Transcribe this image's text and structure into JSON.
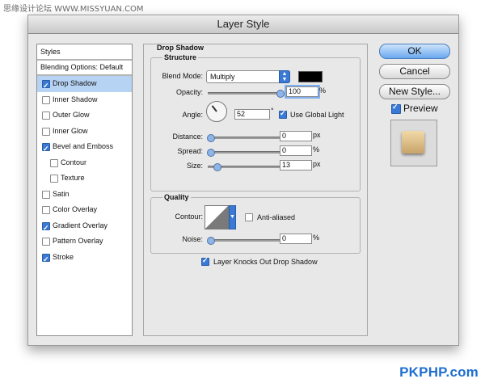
{
  "watermark_top": "思缘设计论坛 WWW.MISSYUAN.COM",
  "watermark_bottom": "PKPHP.com",
  "window": {
    "title": "Layer Style"
  },
  "styles_panel": {
    "header": "Styles",
    "blending_options": "Blending Options: Default",
    "items": [
      {
        "label": "Drop Shadow",
        "checked": true,
        "selected": true,
        "sub": false
      },
      {
        "label": "Inner Shadow",
        "checked": false,
        "selected": false,
        "sub": false
      },
      {
        "label": "Outer Glow",
        "checked": false,
        "selected": false,
        "sub": false
      },
      {
        "label": "Inner Glow",
        "checked": false,
        "selected": false,
        "sub": false
      },
      {
        "label": "Bevel and Emboss",
        "checked": true,
        "selected": false,
        "sub": false
      },
      {
        "label": "Contour",
        "checked": false,
        "selected": false,
        "sub": true
      },
      {
        "label": "Texture",
        "checked": false,
        "selected": false,
        "sub": true
      },
      {
        "label": "Satin",
        "checked": false,
        "selected": false,
        "sub": false
      },
      {
        "label": "Color Overlay",
        "checked": false,
        "selected": false,
        "sub": false
      },
      {
        "label": "Gradient Overlay",
        "checked": true,
        "selected": false,
        "sub": false
      },
      {
        "label": "Pattern Overlay",
        "checked": false,
        "selected": false,
        "sub": false
      },
      {
        "label": "Stroke",
        "checked": true,
        "selected": false,
        "sub": false
      }
    ]
  },
  "drop_shadow": {
    "title": "Drop Shadow",
    "structure": {
      "title": "Structure",
      "blend_mode_label": "Blend Mode:",
      "blend_mode_value": "Multiply",
      "shadow_color": "#000000",
      "opacity_label": "Opacity:",
      "opacity_value": "100",
      "opacity_unit": "%",
      "opacity_fraction": 1.0,
      "angle_label": "Angle:",
      "angle_value": "52",
      "angle_unit": "°",
      "use_global_light_label": "Use Global Light",
      "use_global_light_checked": true,
      "distance_label": "Distance:",
      "distance_value": "0",
      "distance_unit": "px",
      "distance_fraction": 0.0,
      "spread_label": "Spread:",
      "spread_value": "0",
      "spread_unit": "%",
      "spread_fraction": 0.0,
      "size_label": "Size:",
      "size_value": "13",
      "size_unit": "px",
      "size_fraction": 0.09
    },
    "quality": {
      "title": "Quality",
      "contour_label": "Contour:",
      "anti_aliased_label": "Anti-aliased",
      "anti_aliased_checked": false,
      "noise_label": "Noise:",
      "noise_value": "0",
      "noise_unit": "%",
      "noise_fraction": 0.0
    },
    "knockout_label": "Layer Knocks Out Drop Shadow",
    "knockout_checked": true
  },
  "buttons": {
    "ok": "OK",
    "cancel": "Cancel",
    "new_style": "New Style...",
    "preview_label": "Preview",
    "preview_checked": true
  },
  "colors": {
    "accent": "#3a7ad6",
    "selection": "#b6d3f3",
    "preview_tile": "#e6c88f"
  }
}
